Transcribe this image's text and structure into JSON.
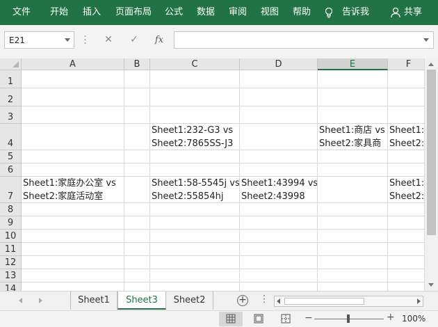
{
  "ribbon": {
    "tabs": [
      "文件",
      "开始",
      "插入",
      "页面布局",
      "公式",
      "数据",
      "审阅",
      "视图",
      "帮助"
    ],
    "tell_me": "告诉我",
    "share": "共享",
    "icons": [
      "lightbulb-icon",
      "person-icon"
    ],
    "color": "#217346"
  },
  "formula_bar": {
    "name_box": "E21",
    "cancel_icon": "✕",
    "enter_icon": "✓",
    "fx_label": "fx",
    "value": ""
  },
  "sheet": {
    "columns": [
      "A",
      "B",
      "C",
      "D",
      "E",
      "F"
    ],
    "selected_column": "E",
    "rows": [
      "1",
      "2",
      "3",
      "4",
      "5",
      "6",
      "7",
      "8",
      "9",
      "10",
      "11",
      "12",
      "13",
      "14"
    ],
    "cells": {
      "C4": "Sheet1:232-G3 vs\nSheet2:7865SS-J3",
      "E4": "Sheet1:商店 vs\nSheet2:家具商",
      "F4": "Sheet1:\nSheet2:",
      "A7": "Sheet1:家庭办公室 vs\nSheet2:家庭活动室",
      "C7": "Sheet1:58-5545j vs\nSheet2:55854hj",
      "D7": "Sheet1:43994 vs\nSheet2:43998",
      "F7": "Sheet1:\nSheet2:"
    }
  },
  "sheet_tabs": {
    "tabs": [
      "Sheet1",
      "Sheet3",
      "Sheet2"
    ],
    "active": "Sheet3",
    "add_icon": "+",
    "overflow": "⋮"
  },
  "status_bar": {
    "zoom": "100%",
    "zoom_minus": "−",
    "zoom_plus": "+",
    "views": [
      "normal-view-icon",
      "page-layout-view-icon",
      "page-break-view-icon"
    ],
    "active_view": "normal-view-icon"
  }
}
